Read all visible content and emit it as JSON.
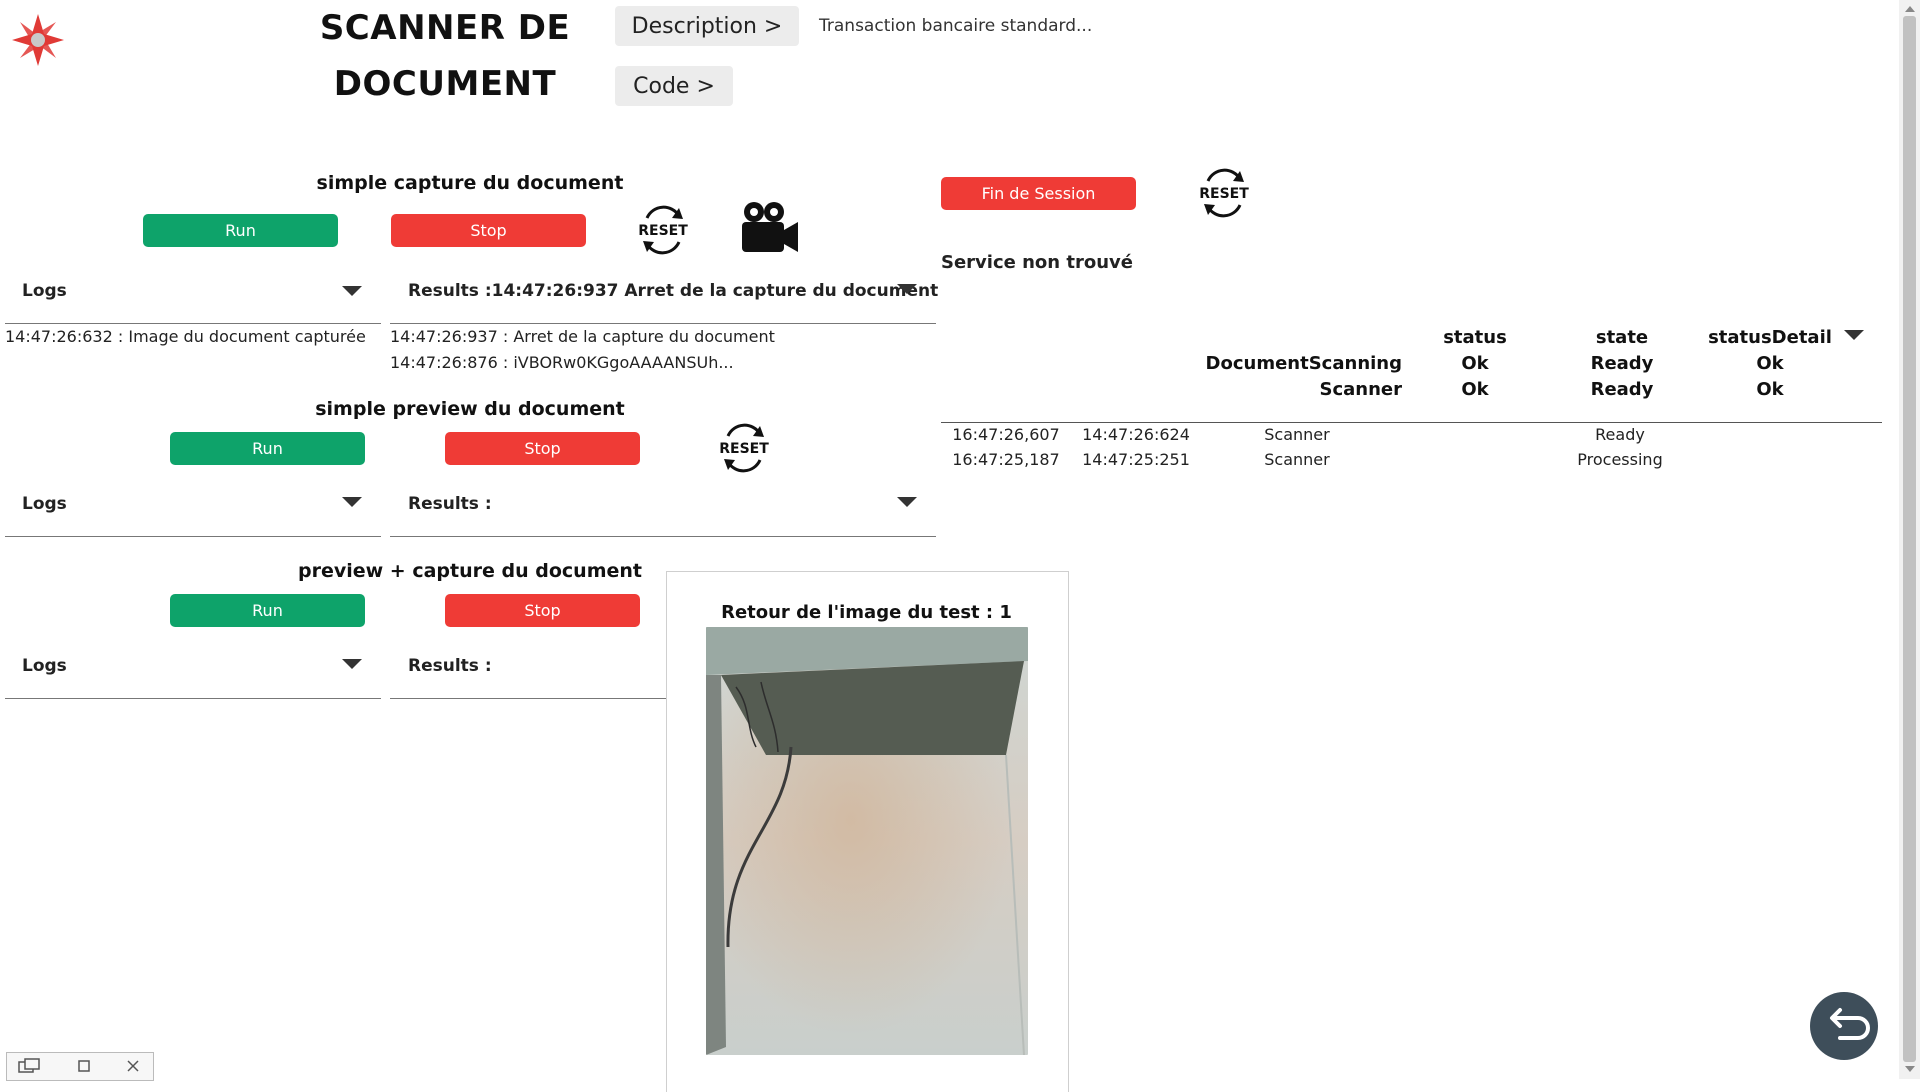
{
  "header": {
    "title_line1": "SCANNER DE",
    "title_line2": "DOCUMENT",
    "description_button": "Description >",
    "code_button": "Code >",
    "description_text": "Transaction bancaire standard..."
  },
  "section1": {
    "title": "simple capture du document",
    "run": "Run",
    "stop": "Stop",
    "logs_label": "Logs",
    "results_label": "Results :14:47:26:937 Arret de la capture du document",
    "logs_lines": [
      "14:47:26:632 : Image du document capturée"
    ],
    "results_lines": [
      "14:47:26:937 : Arret de la capture du document",
      "14:47:26:876 : iVBORw0KGgoAAAANSUh..."
    ]
  },
  "section2": {
    "title": "simple preview du document",
    "run": "Run",
    "stop": "Stop",
    "logs_label": "Logs",
    "results_label": "Results :"
  },
  "section3": {
    "title": "preview + capture du document",
    "run": "Run",
    "stop": "Stop",
    "logs_label": "Logs",
    "results_label": "Results :"
  },
  "session": {
    "end_button": "Fin de Session",
    "service_status": "Service non trouvé"
  },
  "reset_label": "RESET",
  "status_table": {
    "headers": [
      "status",
      "state",
      "statusDetail"
    ],
    "rows": [
      {
        "name": "DocumentScanning",
        "status": "Ok",
        "state": "Ready",
        "detail": "Ok"
      },
      {
        "name": "Scanner",
        "status": "Ok",
        "state": "Ready",
        "detail": "Ok"
      }
    ]
  },
  "events": [
    {
      "t1": "16:47:26,607",
      "t2": "14:47:26:624",
      "device": "Scanner",
      "state": "Ready"
    },
    {
      "t1": "16:47:25,187",
      "t2": "14:47:25:251",
      "device": "Scanner",
      "state": "Processing"
    }
  ],
  "image_panel": {
    "title": "Retour de l'image du test : 1"
  },
  "colors": {
    "run_green": "#0ea36a",
    "stop_red": "#ef3b36",
    "logo_red": "#e03a36"
  },
  "icons": [
    "star-logo-icon",
    "reset-icon",
    "video-camera-icon",
    "caret-down-icon",
    "back-arrow-icon"
  ]
}
